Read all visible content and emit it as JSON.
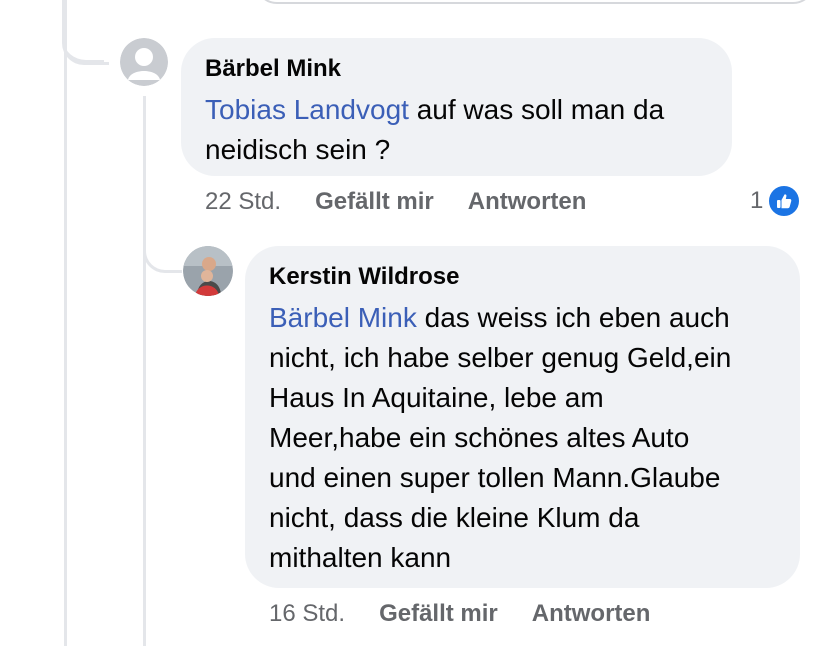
{
  "comments": [
    {
      "author": "Bärbel Mink",
      "mention": "Tobias Landvogt",
      "text_line1": " auf was soll man da",
      "text_line2": "neidisch sein ?",
      "time": "22 Std.",
      "like_label": "Gefällt mir",
      "reply_label": "Antworten",
      "reaction_count": "1",
      "reaction_icon": "thumbs-up-icon",
      "avatar_icon": "default-user-avatar-icon"
    },
    {
      "author": "Kerstin Wildrose",
      "mention": "Bärbel Mink",
      "text_line1": " das weiss ich eben auch",
      "text_line2": "nicht, ich habe selber genug Geld,ein",
      "text_line3": "Haus In Aquitaine, lebe am",
      "text_line4": "Meer,habe ein schönes altes Auto",
      "text_line5": "und einen super tollen Mann.Glaube",
      "text_line6": "nicht, dass die kleine Klum da",
      "text_line7": "mithalten kann",
      "time": "16 Std.",
      "like_label": "Gefällt mir",
      "reply_label": "Antworten",
      "avatar_icon": "profile-photo-avatar"
    }
  ],
  "colors": {
    "bubble": "#f0f2f5",
    "mention": "#3b5fb7",
    "meta": "#65676b",
    "like_blue": "#1b74e4",
    "thread_line": "#e4e6ea"
  }
}
